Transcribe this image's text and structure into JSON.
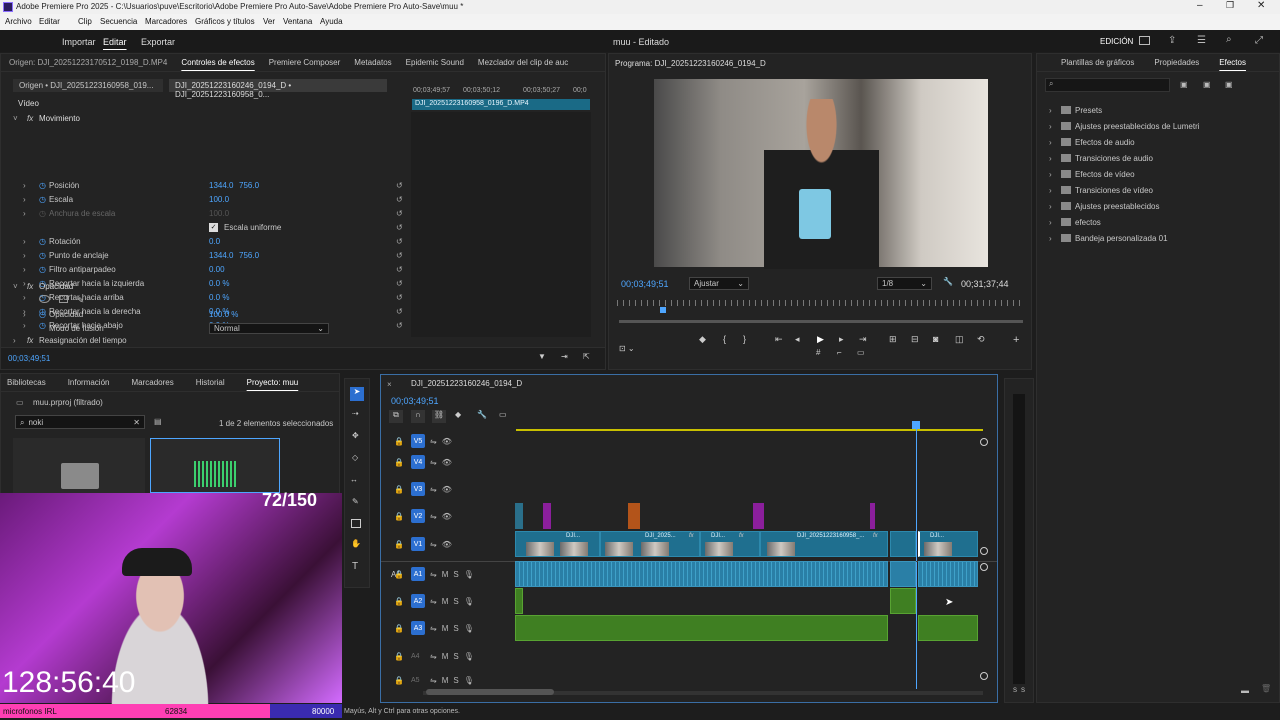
{
  "window": {
    "title": "Adobe Premiere Pro 2025 - C:\\Usuarios\\puve\\Escritorio\\Adobe Premiere Pro Auto-Save\\Adobe Premiere Pro Auto-Save\\muu *"
  },
  "menu": [
    "Archivo",
    "Editar",
    "Clip",
    "Secuencia",
    "Marcadores",
    "Gráficos y títulos",
    "Ver",
    "Ventana",
    "Ayuda"
  ],
  "workspace": {
    "tabs": [
      "Importar",
      "Editar",
      "Exportar"
    ],
    "project_title": "muu - Editado",
    "mode": "EDICIÓN"
  },
  "effect_controls": {
    "tabs": [
      "Origen: DJI_20251223170512_0198_D.MP4",
      "Controles de efectos",
      "Premiere Composer",
      "Metadatos",
      "Epidemic Sound",
      "Mezclador del clip de auc"
    ],
    "source_tab": "Origen • DJI_20251223160958_019...",
    "seq_clip": "DJI_20251223160246_0194_D • DJI_20251223160958_0...",
    "ruler": [
      "00;03;49;57",
      "00;03;50;12",
      "00;03;50;27",
      "00;0"
    ],
    "clip_bar": "DJI_20251223160958_0196_D.MP4",
    "section": "Vídeo",
    "group": "Movimiento",
    "props": [
      {
        "name": "Posición",
        "v1": "1344.0",
        "v2": "756.0"
      },
      {
        "name": "Escala",
        "v1": "100.0",
        "v2": ""
      },
      {
        "name": "Anchura de escala",
        "v1": "100.0",
        "v2": ""
      },
      {
        "name": "Escala uniforme",
        "v1": "",
        "v2": ""
      },
      {
        "name": "Rotación",
        "v1": "0.0",
        "v2": ""
      },
      {
        "name": "Punto de anclaje",
        "v1": "1344.0",
        "v2": "756.0"
      },
      {
        "name": "Filtro antiparpadeo",
        "v1": "0.00",
        "v2": ""
      },
      {
        "name": "Recortar hacia la izquierda",
        "v1": "0.0 %",
        "v2": ""
      },
      {
        "name": "Recortar hacia arriba",
        "v1": "0.0 %",
        "v2": ""
      },
      {
        "name": "Recortar hacia la derecha",
        "v1": "0.0 %",
        "v2": ""
      },
      {
        "name": "Recortar hacia abajo",
        "v1": "0.0 %",
        "v2": ""
      }
    ],
    "opacity_group": "Opacidad",
    "opacity_label": "Opacidad",
    "opacity_value": "100.0 %",
    "blend_label": "Modo de fusión",
    "blend_value": "Normal",
    "remap": "Reasignación del tiempo",
    "timecode": "00;03;49;51"
  },
  "program": {
    "title": "Programa: DJI_20251223160246_0194_D",
    "timecode": "00;03;49;51",
    "fit": "Ajustar",
    "resolution": "1/8",
    "duration": "00;31;37;44",
    "playhead": 0.11
  },
  "effects_panel": {
    "tabs": [
      "Plantillas de gráficos",
      "Propiedades",
      "Efectos"
    ],
    "items": [
      "Presets",
      "Ajustes preestablecidos de Lumetri",
      "Efectos de audio",
      "Transiciones de audio",
      "Efectos de vídeo",
      "Transiciones de vídeo",
      "Ajustes preestablecidos",
      "efectos",
      "Bandeja personalizada 01"
    ]
  },
  "project": {
    "tabs": [
      "Bibliotecas",
      "Información",
      "Marcadores",
      "Historial",
      "Proyecto: muu"
    ],
    "file": "muu.prproj (filtrado)",
    "search": "noki",
    "selection": "1 de 2 elementos seleccionados"
  },
  "timeline": {
    "tab": "DJI_20251223160246_0194_D",
    "timecode": "00;03;49;51",
    "tracks": [
      "V5",
      "V4",
      "V3",
      "V2",
      "V1",
      "A1",
      "A2",
      "A3",
      "A4",
      "A5"
    ],
    "source_patch": "A1",
    "clips": [
      "DJI...",
      "DJI_2025...",
      "DJI...",
      "DJI_20251223160958_...",
      "DJI..."
    ]
  },
  "overlay": {
    "counter": "72/150",
    "clock": "128:56:40",
    "goal_label": "microfonos IRL",
    "goal_value": "62834",
    "goal_total": "80000"
  },
  "status": "Mayús, Alt y Ctrl para otras opciones.",
  "meter": [
    "S",
    "S"
  ]
}
